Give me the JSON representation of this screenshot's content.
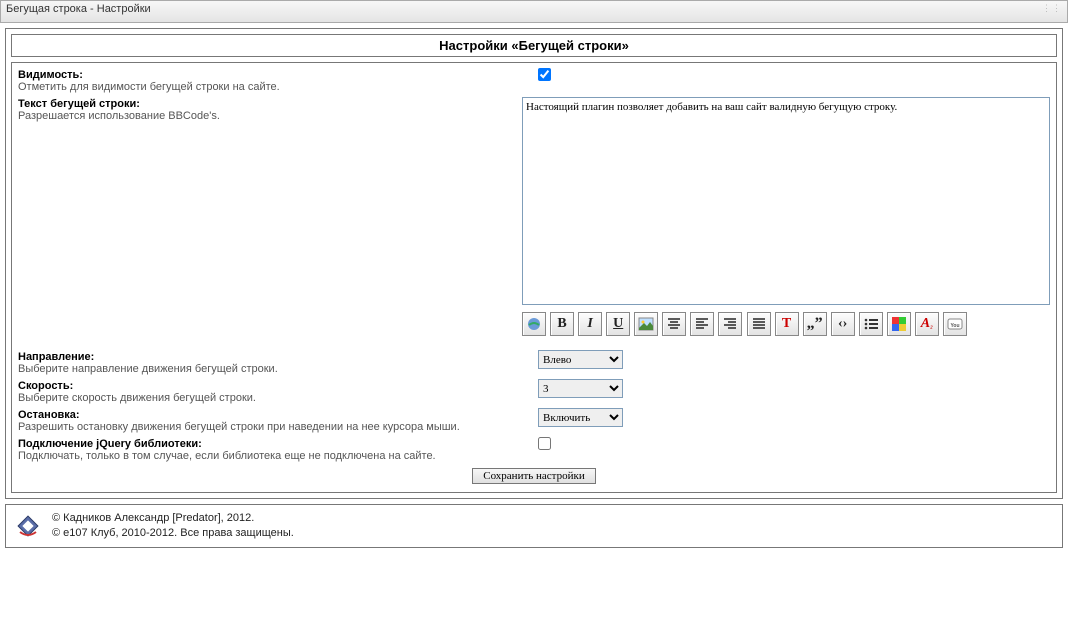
{
  "window": {
    "title": "Бегущая строка - Настройки"
  },
  "panel": {
    "heading": "Настройки «Бегущей строки»"
  },
  "fields": {
    "visibility": {
      "label": "Видимость:",
      "hint": "Отметить для видимости бегущей строки на сайте.",
      "checked": true
    },
    "text": {
      "label": "Текст бегущей строки:",
      "hint": "Разрешается использование BBCode's.",
      "value": "Настоящий плагин позволяет добавить на ваш сайт валидную бегущую строку."
    },
    "direction": {
      "label": "Направление:",
      "hint": "Выберите направление движения бегущей строки.",
      "value": "Влево"
    },
    "speed": {
      "label": "Скорость:",
      "hint": "Выберите скорость движения бегущей строки.",
      "value": "3"
    },
    "stop": {
      "label": "Остановка:",
      "hint": "Разрешить остановку движения бегущей строки при наведении на нее курсора мыши.",
      "value": "Включить"
    },
    "jquery": {
      "label": "Подключение jQuery библиотеки:",
      "hint": "Подключать, только в том случае, если библиотека еще не подключена на сайте.",
      "checked": false
    }
  },
  "toolbar": {
    "bold": "B",
    "italic": "I",
    "underline": "U",
    "text_t": "T",
    "quote": "„”",
    "code": "‹›"
  },
  "buttons": {
    "save": "Сохранить настройки"
  },
  "footer": {
    "line1": "© Кадников Александр [Predator], 2012.",
    "line2": "© e107 Клуб, 2010-2012. Все права защищены."
  }
}
